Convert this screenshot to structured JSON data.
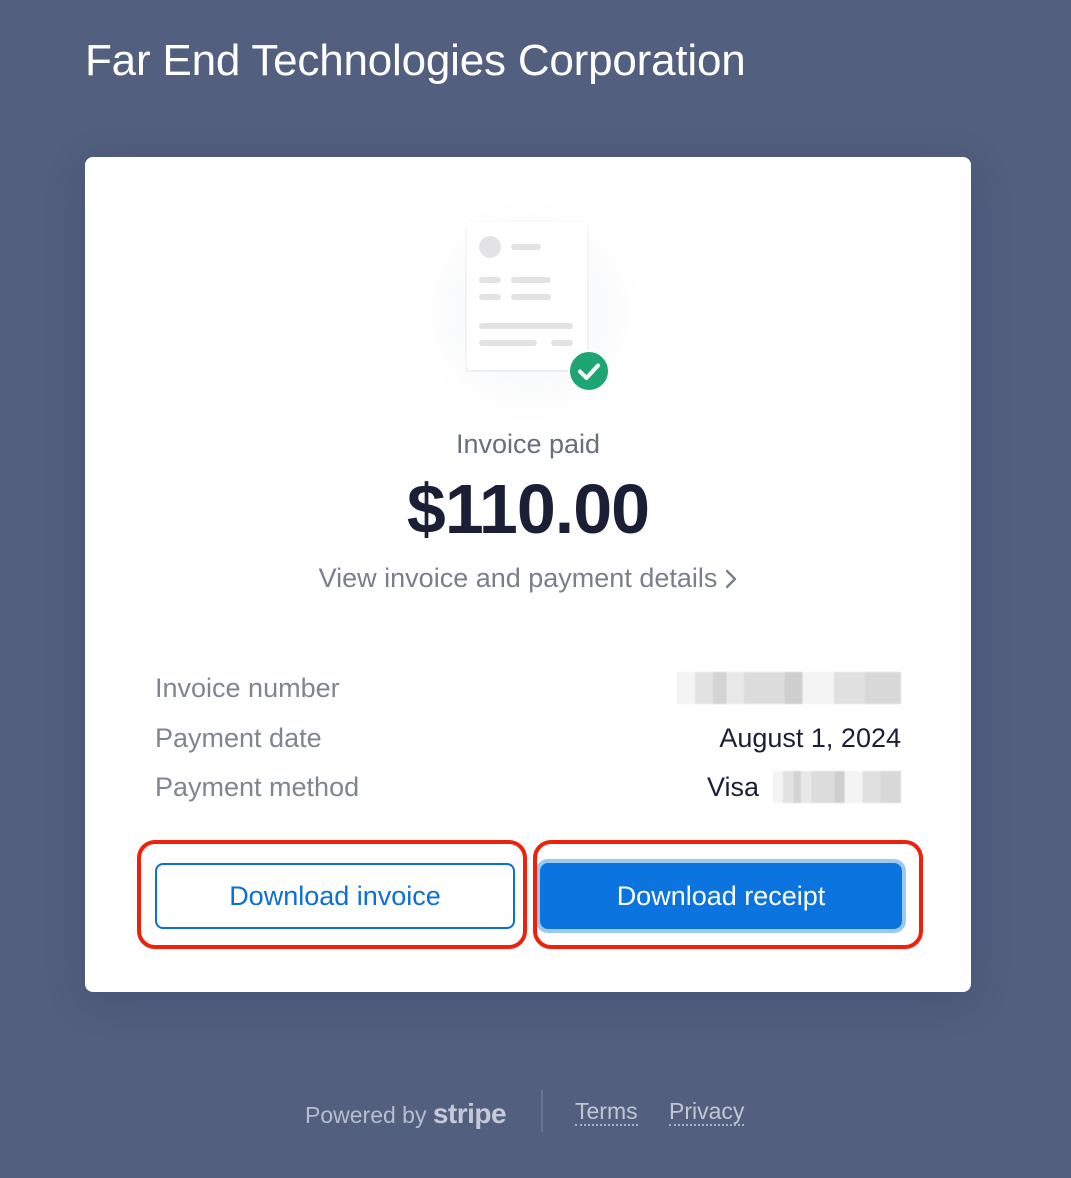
{
  "merchant": {
    "name": "Far End Technologies Corporation"
  },
  "invoice": {
    "status": "Invoice paid",
    "amount": "$110.00",
    "details_link": "View invoice and payment details",
    "details": [
      {
        "label": "Invoice number",
        "value": ""
      },
      {
        "label": "Payment date",
        "value": "August 1, 2024"
      },
      {
        "label": "Payment method",
        "value": "Visa"
      }
    ]
  },
  "actions": {
    "download_invoice": "Download invoice",
    "download_receipt": "Download receipt"
  },
  "footer": {
    "powered_by": "Powered by",
    "brand": "stripe",
    "terms": "Terms",
    "privacy": "Privacy"
  },
  "colors": {
    "background": "#525f7f",
    "primary": "#0b74de",
    "success": "#1ea672",
    "highlight": "#f0200a"
  },
  "icons": {
    "document": "document-illustration-icon",
    "check": "check-circle-icon",
    "chevron": "chevron-right-icon"
  }
}
